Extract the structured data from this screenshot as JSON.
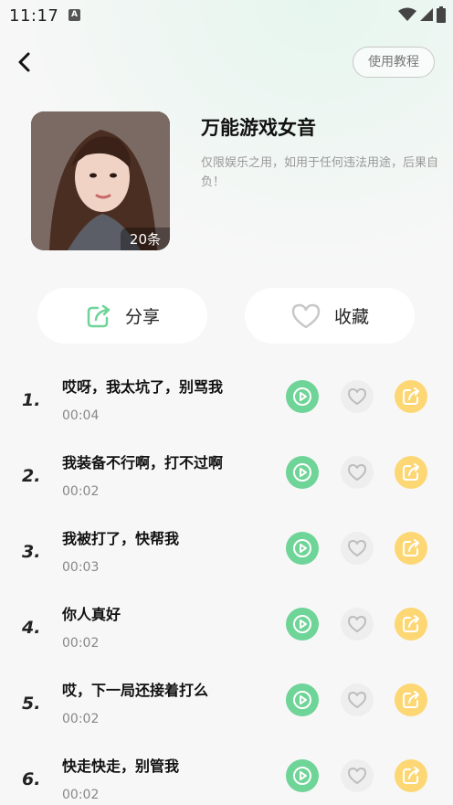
{
  "status_bar": {
    "time": "11:17",
    "notification_icon": "A"
  },
  "header": {
    "tutorial_label": "使用教程"
  },
  "album": {
    "title": "万能游戏女音",
    "description": "仅限娱乐之用，如用于任何违法用途，后果自负！",
    "count_label": "20条"
  },
  "actions": {
    "share_label": "分享",
    "favorite_label": "收藏"
  },
  "tracks": [
    {
      "index": "1.",
      "title": "哎呀，我太坑了，别骂我",
      "duration": "00:04"
    },
    {
      "index": "2.",
      "title": "我装备不行啊，打不过啊",
      "duration": "00:02"
    },
    {
      "index": "3.",
      "title": "我被打了，快帮我",
      "duration": "00:03"
    },
    {
      "index": "4.",
      "title": "你人真好",
      "duration": "00:02"
    },
    {
      "index": "5.",
      "title": "哎，下一局还接着打么",
      "duration": "00:02"
    },
    {
      "index": "6.",
      "title": "快走快走，别管我",
      "duration": "00:02"
    }
  ],
  "colors": {
    "play": "#6ed497",
    "like": "#eeeeee",
    "share": "#fcd774",
    "accent": "#6ed497"
  },
  "icons": {
    "back": "chevron-left-icon",
    "share": "share-icon",
    "favorite": "heart-icon",
    "play": "play-icon",
    "like": "heart-icon",
    "track_share": "share-icon"
  }
}
